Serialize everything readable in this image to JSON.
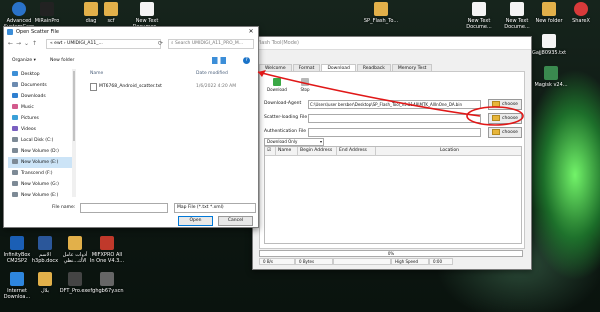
{
  "desktop": {
    "icons": [
      {
        "label": "Advanced\nSystemCare",
        "color": "#2a72c9"
      },
      {
        "label": "MiRainPro",
        "color": "#222"
      },
      {
        "label": "diag",
        "color": "#e2b04a"
      },
      {
        "label": "scf",
        "color": "#e2b04a"
      },
      {
        "label": "New Text\nDocumen...",
        "color": "#f4f4f4"
      },
      {
        "label": "SP_Flash_To...",
        "color": "#e2b04a"
      },
      {
        "label": "New Text\nDocume...",
        "color": "#f4f4f4"
      },
      {
        "label": "New Text\nDocume...",
        "color": "#f4f4f4"
      },
      {
        "label": "New folder",
        "color": "#e2b04a"
      },
      {
        "label": "ShareX",
        "color": "#d83a3a"
      },
      {
        "label": "Gajj80935.txt",
        "color": "#f4f4f4"
      },
      {
        "label": "Magisk v24...",
        "color": "#3a8a4f"
      },
      {
        "label": "InfinityBox\nCM2SP2",
        "color": "#1b5fb5"
      },
      {
        "label": "الاسم\nh3pb.docx",
        "color": "#2b579a"
      },
      {
        "label": "أدوات عامل\nالاك...نظي",
        "color": "#e2b04a"
      },
      {
        "label": "MIFXPRO All\nIn One V4.3...",
        "color": "#c0392b"
      },
      {
        "label": "Internet\nDownloa...",
        "color": "#2e86de"
      },
      {
        "label": "بلال",
        "color": "#e2b04a"
      },
      {
        "label": "DFT_Pro.exe",
        "color": "#444"
      },
      {
        "label": "fghgb67y.scn",
        "color": "#666"
      }
    ]
  },
  "flash_tool": {
    "title": "Flash Tool(Mode)",
    "tabs": [
      "Welcome",
      "Format",
      "Download",
      "Readback",
      "Memory Test"
    ],
    "download_btn": "Download",
    "stop_btn": "Stop",
    "da_label": "Download-Agent",
    "da_path": "C:\\Users\\user bersber\\Desktop\\SP_Flash_Tool_v5.2148\\MTK_AllInOne_DA.bin",
    "scatter_label": "Scatter-loading File",
    "scatter_path": "",
    "auth_label": "Authentication File",
    "auth_path": "",
    "choose_label": "choose",
    "mode_value": "Download Only",
    "columns": [
      "Name",
      "Begin Address",
      "End Address",
      "Location"
    ],
    "progress_text": "0%",
    "status": [
      "0 B/s",
      "0 Bytes",
      "",
      "High Speed",
      "0:00"
    ]
  },
  "dialog": {
    "title": "Open Scatter File",
    "path_segments": "« ewt › UMIDIGI_A11_...",
    "search_placeholder": "Search UMIDIGI_A11_PRO_M...",
    "organize": "Organize ▾",
    "new_folder": "New folder",
    "help": "?",
    "tree": [
      {
        "label": "Desktop",
        "color": "#3d8fd6"
      },
      {
        "label": "Documents",
        "color": "#6c8bb0"
      },
      {
        "label": "Downloads",
        "color": "#2e7fd0"
      },
      {
        "label": "Music",
        "color": "#d25a8c"
      },
      {
        "label": "Pictures",
        "color": "#3aa0d8"
      },
      {
        "label": "Videos",
        "color": "#7a5fc0"
      },
      {
        "label": "Local Disk (C:)",
        "color": "#7d8a96"
      },
      {
        "label": "New Volume (D:)",
        "color": "#7d8a96"
      },
      {
        "label": "New Volume (E:)",
        "color": "#7d8a96"
      },
      {
        "label": "Transcend (F:)",
        "color": "#7d8a96"
      },
      {
        "label": "New Volume (G:)",
        "color": "#7d8a96"
      },
      {
        "label": "New Volume (E:)",
        "color": "#7d8a96"
      }
    ],
    "selected_tree_index": 8,
    "col_name": "Name",
    "col_date": "Date modified",
    "files": [
      {
        "name": "MT6768_Android_scatter.txt",
        "date": "1/6/2022 4:20 AM"
      }
    ],
    "file_name_label": "File name:",
    "file_name_value": "",
    "file_type": "Map File (*.txt *.xml)",
    "open_btn": "Open",
    "cancel_btn": "Cancel"
  }
}
